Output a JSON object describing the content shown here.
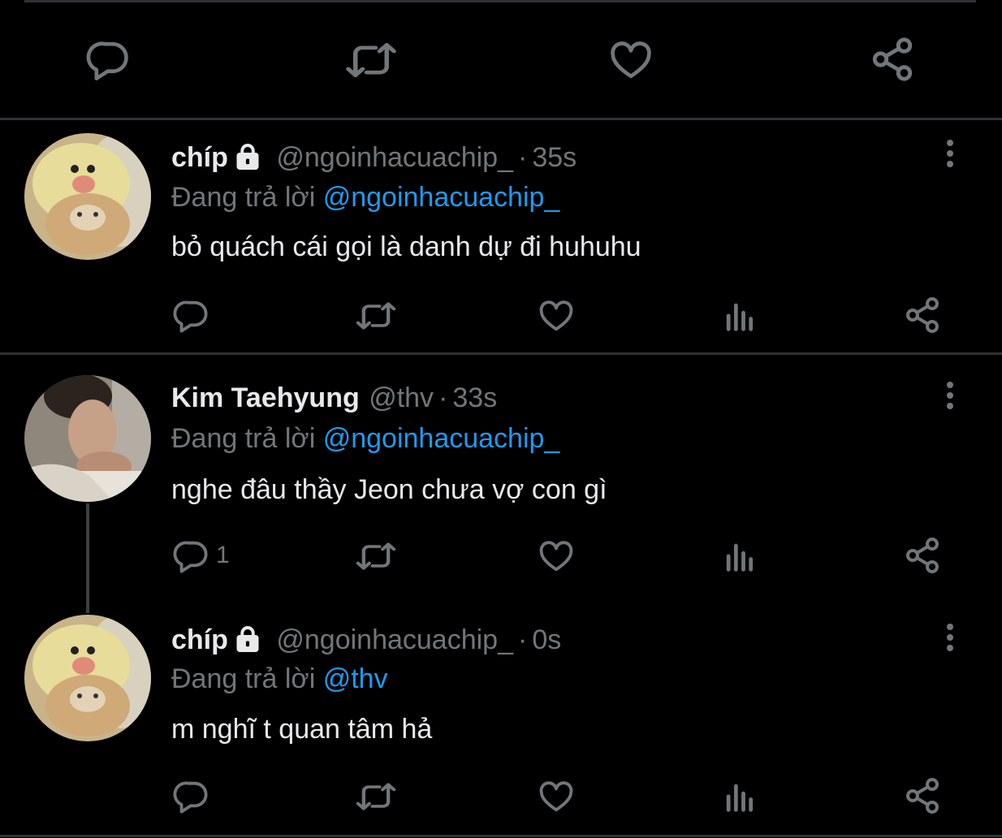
{
  "colors": {
    "background": "#000000",
    "text": "#e7e9ea",
    "muted": "#71767b",
    "accent": "#1d9bf0",
    "separator": "#2f3336"
  },
  "top_actions": {
    "icons": [
      "reply-icon",
      "retweet-icon",
      "like-icon",
      "share-icon"
    ]
  },
  "tweets": [
    {
      "display_name": "chíp",
      "protected": true,
      "handle": "@ngoinhacuachip_",
      "separator": "·",
      "time": "35s",
      "replying_label": "Đang trả lời",
      "replying_to": "@ngoinhacuachip_",
      "text": "bỏ quách cái gọi là danh dự đi huhuhu",
      "avatar": "cat-in-chick-hat-avatar",
      "reply_count": ""
    },
    {
      "display_name": "Kim Taehyung",
      "protected": false,
      "handle": "@thv",
      "separator": "·",
      "time": "33s",
      "replying_label": "Đang trả lời",
      "replying_to": "@ngoinhacuachip_",
      "text": "nghe đâu thầy Jeon chưa vợ con gì",
      "avatar": "person-photo-avatar",
      "reply_count": "1"
    },
    {
      "display_name": "chíp",
      "protected": true,
      "handle": "@ngoinhacuachip_",
      "separator": "·",
      "time": "0s",
      "replying_label": "Đang trả lời",
      "replying_to": "@thv",
      "text": "m nghĩ t quan tâm hả",
      "avatar": "cat-in-chick-hat-avatar",
      "reply_count": ""
    }
  ],
  "tweet_actions": {
    "icons": [
      "reply-icon",
      "retweet-icon",
      "like-icon",
      "analytics-icon",
      "share-icon"
    ]
  }
}
